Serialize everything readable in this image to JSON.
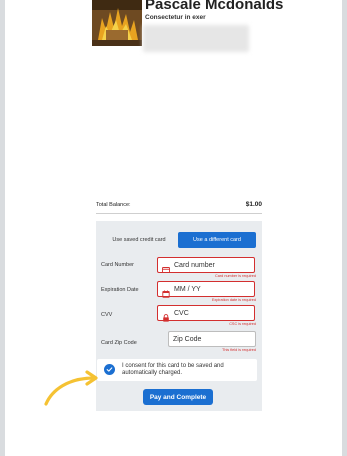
{
  "profile": {
    "name": "Pascale Mcdonalds",
    "subtitle": "Consectetur in exer"
  },
  "balance": {
    "label": "Total Balance:",
    "value": "$1.00"
  },
  "payment_toggle": {
    "saved_label": "Use saved credit card",
    "different_label": "Use a different card"
  },
  "fields": {
    "card_number": {
      "label": "Card Number",
      "placeholder": "Card number",
      "error": "Card number is required",
      "icon": "credit-card-icon"
    },
    "expiration": {
      "label": "Expiration Date",
      "placeholder": "MM / YY",
      "error": "Expiration date is required",
      "icon": "calendar-icon"
    },
    "cvv": {
      "label": "CVV",
      "placeholder": "CVC",
      "error": "CSC is required",
      "icon": "lock-icon"
    },
    "zip": {
      "label": "Card Zip Code",
      "placeholder": "Zip Code",
      "error": "This field is required"
    }
  },
  "consent": {
    "text": "I consent for this card to be saved and automatically charged.",
    "checked": true
  },
  "pay_button": {
    "label": "Pay and Complete"
  },
  "colors": {
    "accent": "#1b6fd1",
    "error": "#d32f2f",
    "panel": "#e9ecef",
    "arrow": "#f5c233"
  }
}
